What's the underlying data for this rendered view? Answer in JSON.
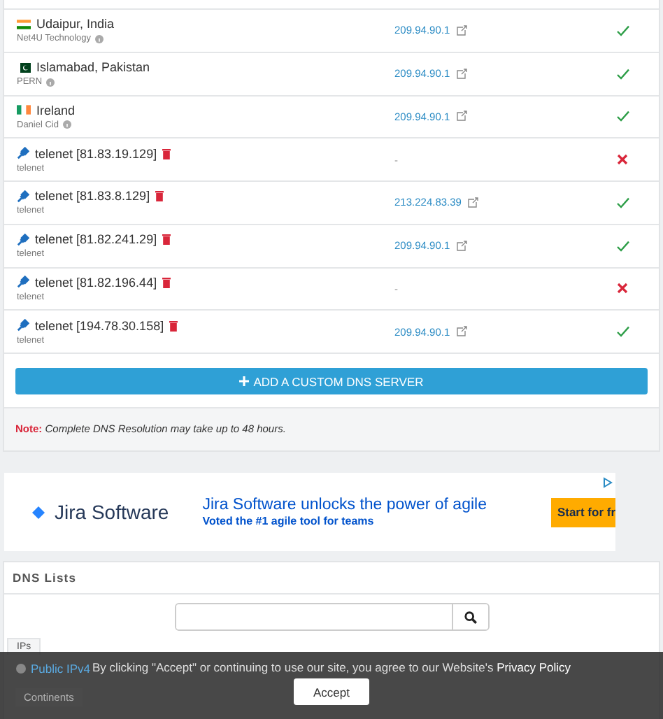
{
  "servers": [
    {
      "kind": "india",
      "location": "Udaipur, India",
      "provider": "Net4U Technology",
      "ip": "209.94.90.1",
      "ok": true
    },
    {
      "kind": "pakistan",
      "location": "Islamabad, Pakistan",
      "provider": "PERN",
      "ip": "209.94.90.1",
      "ok": true
    },
    {
      "kind": "ireland",
      "location": "Ireland",
      "provider": "Daniel Cid",
      "ip": "209.94.90.1",
      "ok": true
    },
    {
      "kind": "custom",
      "location": "telenet [81.83.19.129]",
      "provider": "telenet",
      "ip": "-",
      "ok": false
    },
    {
      "kind": "custom",
      "location": "telenet [81.83.8.129]",
      "provider": "telenet",
      "ip": "213.224.83.39",
      "ok": true
    },
    {
      "kind": "custom",
      "location": "telenet [81.82.241.29]",
      "provider": "telenet",
      "ip": "209.94.90.1",
      "ok": true
    },
    {
      "kind": "custom",
      "location": "telenet [81.82.196.44]",
      "provider": "telenet",
      "ip": "-",
      "ok": false
    },
    {
      "kind": "custom",
      "location": "telenet [194.78.30.158]",
      "provider": "telenet",
      "ip": "209.94.90.1",
      "ok": true
    }
  ],
  "add_button": "ADD A CUSTOM DNS SERVER",
  "note": {
    "label": "Note:",
    "text": "Complete DNS Resolution may take up to 48 hours."
  },
  "ad": {
    "brand": "Jira Software",
    "headline": "Jira Software unlocks the power of agile",
    "subline": "Voted the #1 agile tool for teams",
    "cta": "Start for fr"
  },
  "dns_lists": {
    "title": "DNS Lists",
    "tabs": [
      "IPs"
    ],
    "links": [
      "Public IPv4",
      "Continents"
    ]
  },
  "cookie": {
    "text": "By clicking \"Accept\" or continuing to use our site, you agree to our Website's",
    "link": "Privacy Policy",
    "button": "Accept"
  }
}
